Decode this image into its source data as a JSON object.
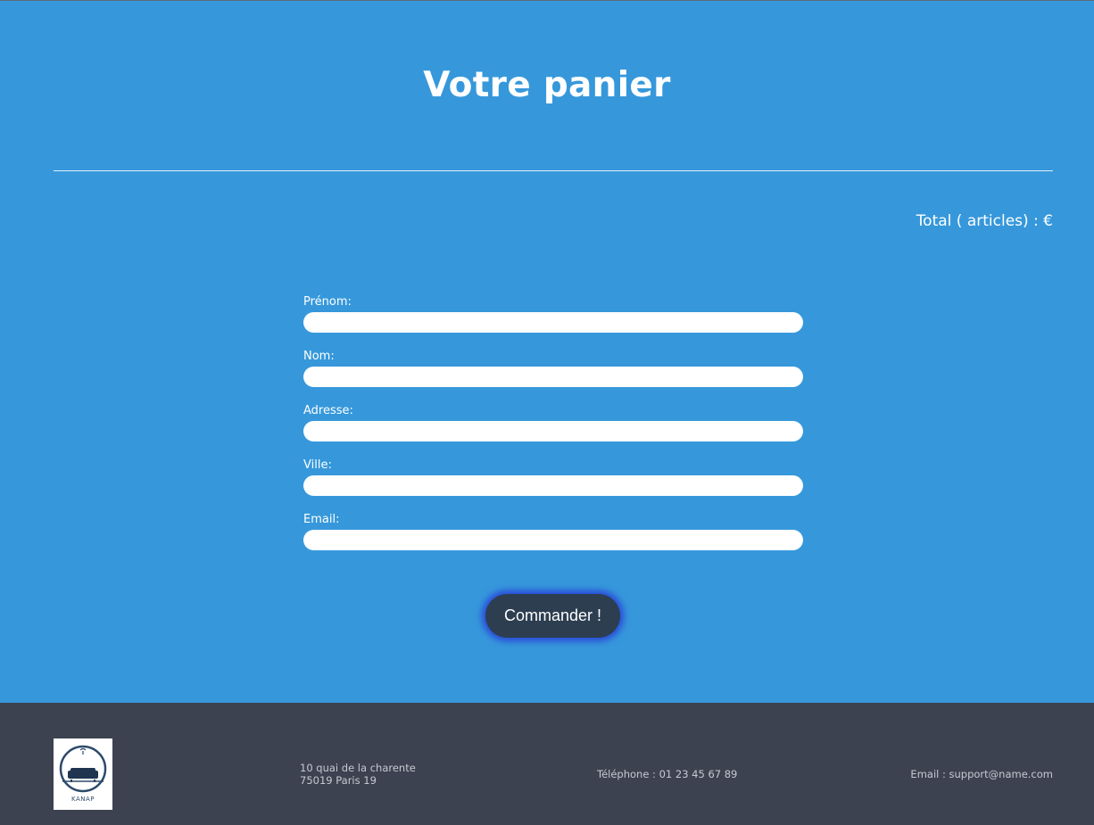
{
  "page": {
    "title": "Votre panier",
    "total_label": "Total ( articles) : €"
  },
  "form": {
    "fields": [
      {
        "label": "Prénom:",
        "value": ""
      },
      {
        "label": "Nom:",
        "value": ""
      },
      {
        "label": "Adresse:",
        "value": ""
      },
      {
        "label": "Ville:",
        "value": ""
      },
      {
        "label": "Email:",
        "value": ""
      }
    ],
    "submit_label": "Commander !"
  },
  "footer": {
    "logo_text": "KANAP",
    "address_line1": "10 quai de la charente",
    "address_line2": "75019 Paris 19",
    "phone": "Téléphone : 01 23 45 67 89",
    "email": "Email : support@name.com"
  },
  "colors": {
    "background": "#3698db",
    "button": "#2c3e50",
    "button_glow": "#2a48d8",
    "footer": "#3d4250"
  }
}
